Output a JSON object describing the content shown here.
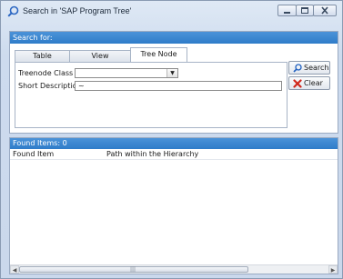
{
  "window": {
    "title": "Search in 'SAP Program Tree'",
    "colors": {
      "frame": "#cddbee",
      "panel_header": "#3a86d0",
      "clear_icon": "#d0281c",
      "search_icon": "#1f5fbf"
    }
  },
  "search_panel": {
    "header": "Search for:",
    "tabs": [
      {
        "label": "Table",
        "active": false
      },
      {
        "label": "View",
        "active": false
      },
      {
        "label": "Tree Node",
        "active": true
      }
    ],
    "fields": {
      "class_id_label": "Treenode Class ID",
      "class_id_value": "",
      "short_description_label": "Short Description",
      "short_description_value": "~"
    },
    "buttons": {
      "search_label": "Search",
      "search_icon": "search-icon",
      "clear_label": "Clear",
      "clear_icon": "clear-x-icon"
    }
  },
  "results_panel": {
    "header": "Found Items:  0",
    "columns": [
      "Found Item",
      "Path within the Hierarchy"
    ],
    "rows": []
  }
}
